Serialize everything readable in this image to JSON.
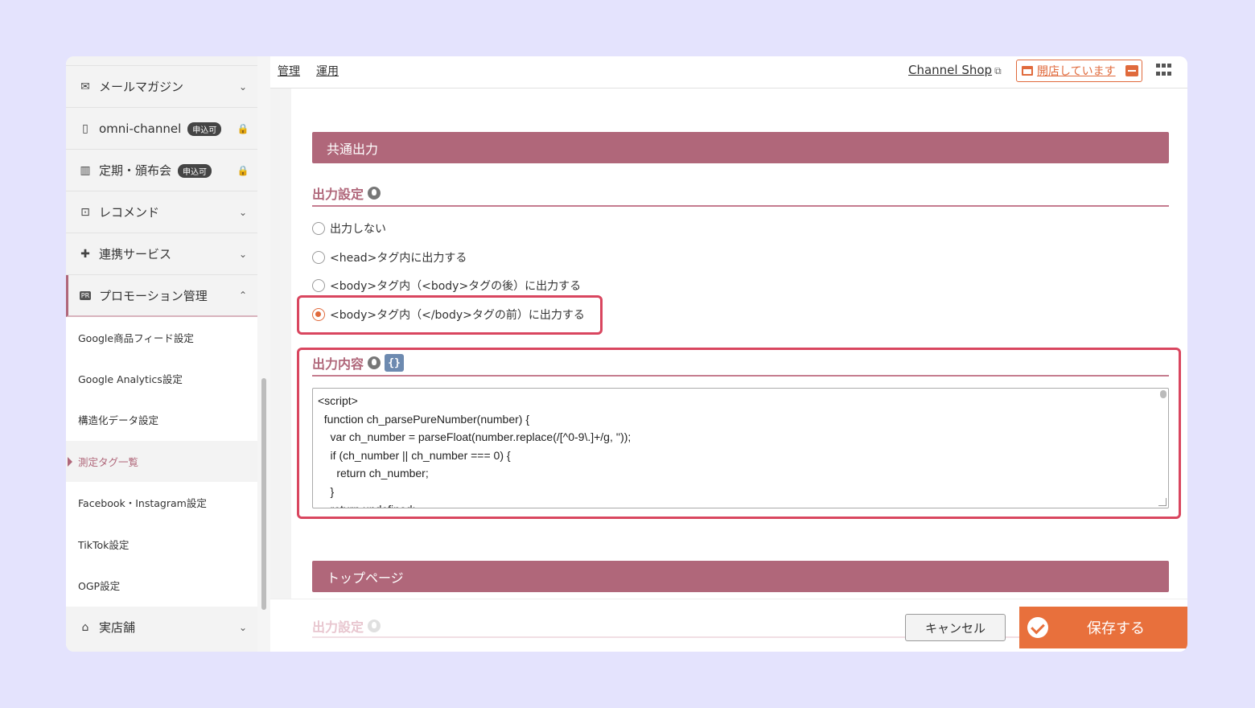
{
  "sidebar": {
    "items": [
      {
        "label": "メールマガジン",
        "icon": "mail-icon",
        "badge": ""
      },
      {
        "label": "omni-channel",
        "icon": "phone-icon",
        "badge": "申込可"
      },
      {
        "label": "定期・頒布会",
        "icon": "calendar-icon",
        "badge": "申込可"
      },
      {
        "label": "レコメンド",
        "icon": "star-box-icon",
        "badge": ""
      },
      {
        "label": "連携サービス",
        "icon": "puzzle-icon",
        "badge": ""
      },
      {
        "label": "プロモーション管理",
        "icon": "pr-icon",
        "badge": ""
      }
    ],
    "sub_items": [
      "Google商品フィード設定",
      "Google Analytics設定",
      "構造化データ設定",
      "測定タグ一覧",
      "Facebook・Instagram設定",
      "TikTok設定",
      "OGP設定"
    ],
    "store_label": "実店舗",
    "pr_icon_text": "PR"
  },
  "topnav": {
    "link_manage": "管理",
    "link_operate": "運用",
    "shop_link": "Channel Shop",
    "open_status": "開店しています"
  },
  "main": {
    "section_common": "共通出力",
    "output_setting": "出力設定",
    "radios": [
      "出力しない",
      "<head>タグ内に出力する",
      "<body>タグ内（<body>タグの後）に出力する",
      "<body>タグ内（</body>タグの前）に出力する"
    ],
    "output_content": "出力内容",
    "code_icon_text": "{}",
    "code": "<script>\n  function ch_parsePureNumber(number) {\n    var ch_number = parseFloat(number.replace(/[^0-9\\.]+/g, ''));\n    if (ch_number || ch_number === 0) {\n      return ch_number;\n    }\n    return undefined;",
    "section_top": "トップページ"
  },
  "footer": {
    "faded_heading": "出力設定",
    "cancel": "キャンセル",
    "save": "保存する"
  },
  "colors": {
    "accent": "#b0677a",
    "orange": "#e8703c",
    "highlight": "#d9465f"
  }
}
